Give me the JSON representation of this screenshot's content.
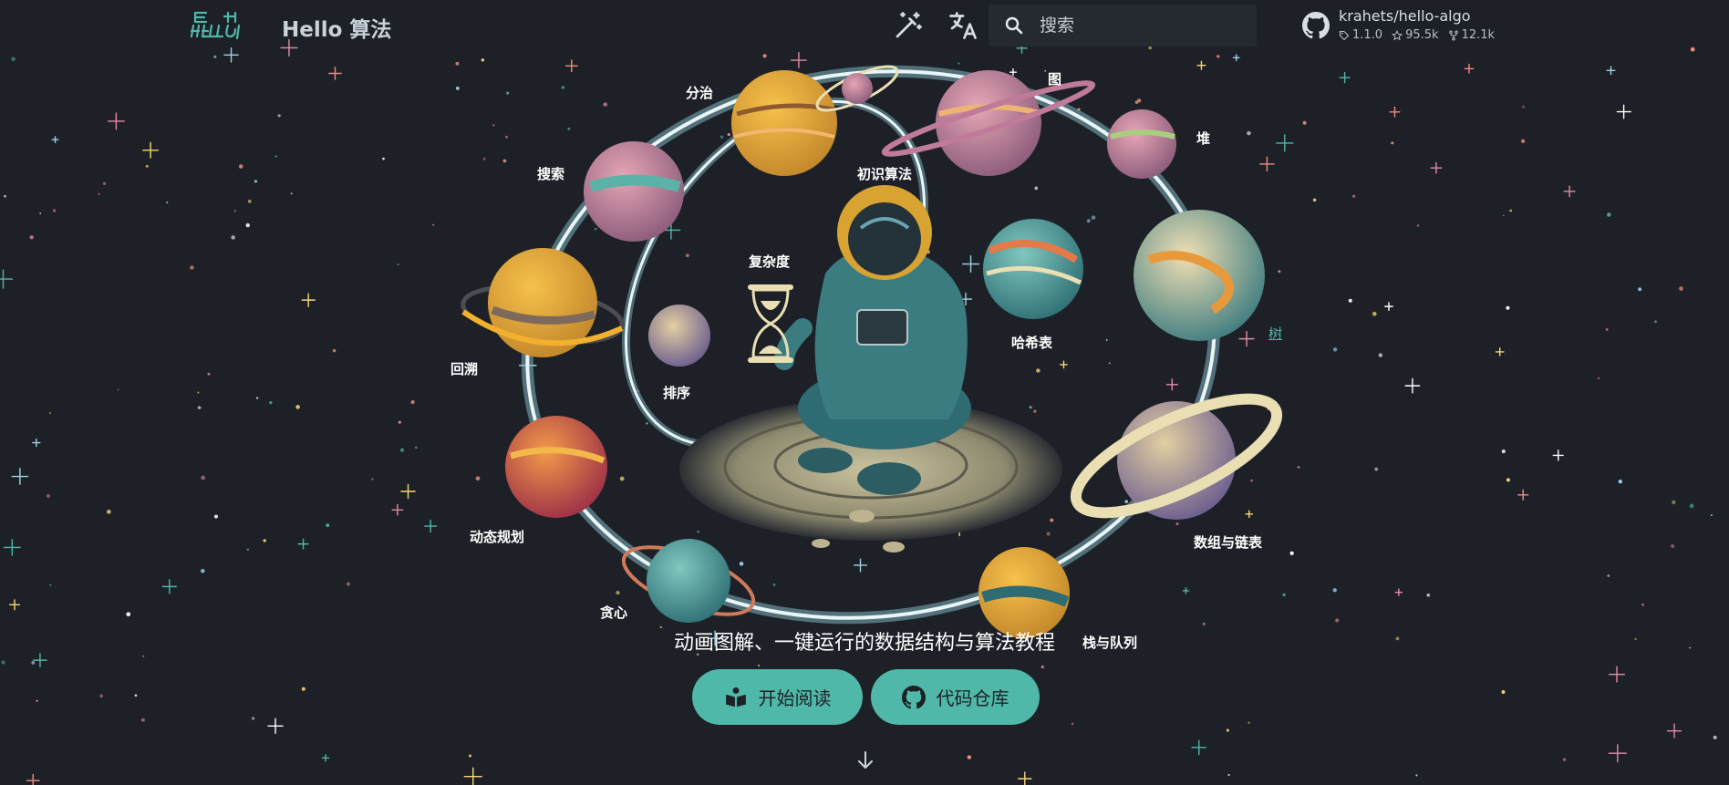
{
  "header": {
    "logo_text": "HELLO 算法",
    "title": "Hello 算法",
    "palette_icon": "magic-wand-icon",
    "language_icon": "translate-icon",
    "search": {
      "placeholder": "搜索",
      "icon": "search-icon"
    },
    "repo": {
      "name": "krahets/hello-algo",
      "version": "1.1.0",
      "stars": "95.5k",
      "forks": "12.1k"
    }
  },
  "hero": {
    "illustration": "astronaut-with-hourglass-in-planet-ring",
    "planets": [
      {
        "id": "divide-conquer",
        "label": "分治"
      },
      {
        "id": "graph",
        "label": "图"
      },
      {
        "id": "heap",
        "label": "堆"
      },
      {
        "id": "search",
        "label": "搜索"
      },
      {
        "id": "intro-algorithms",
        "label": "初识算法"
      },
      {
        "id": "complexity",
        "label": "复杂度"
      },
      {
        "id": "tree",
        "label": "树"
      },
      {
        "id": "backtracking",
        "label": "回溯"
      },
      {
        "id": "sorting",
        "label": "排序"
      },
      {
        "id": "hash-table",
        "label": "哈希表"
      },
      {
        "id": "dynamic-programming",
        "label": "动态规划"
      },
      {
        "id": "array-linked-list",
        "label": "数组与链表"
      },
      {
        "id": "greedy",
        "label": "贪心"
      },
      {
        "id": "stack-queue",
        "label": "栈与队列"
      }
    ],
    "tagline": "动画图解、一键运行的数据结构与算法教程",
    "buttons": {
      "start_reading": {
        "label": "开始阅读",
        "icon": "book-reader-icon"
      },
      "code_repo": {
        "label": "代码仓库",
        "icon": "github-icon"
      }
    },
    "scroll_icon": "arrow-down-icon"
  },
  "colors": {
    "background": "#1d2127",
    "accent": "#4fb8a9",
    "tree_label": "#4fb8a9",
    "ring": "#cfe7ec"
  }
}
